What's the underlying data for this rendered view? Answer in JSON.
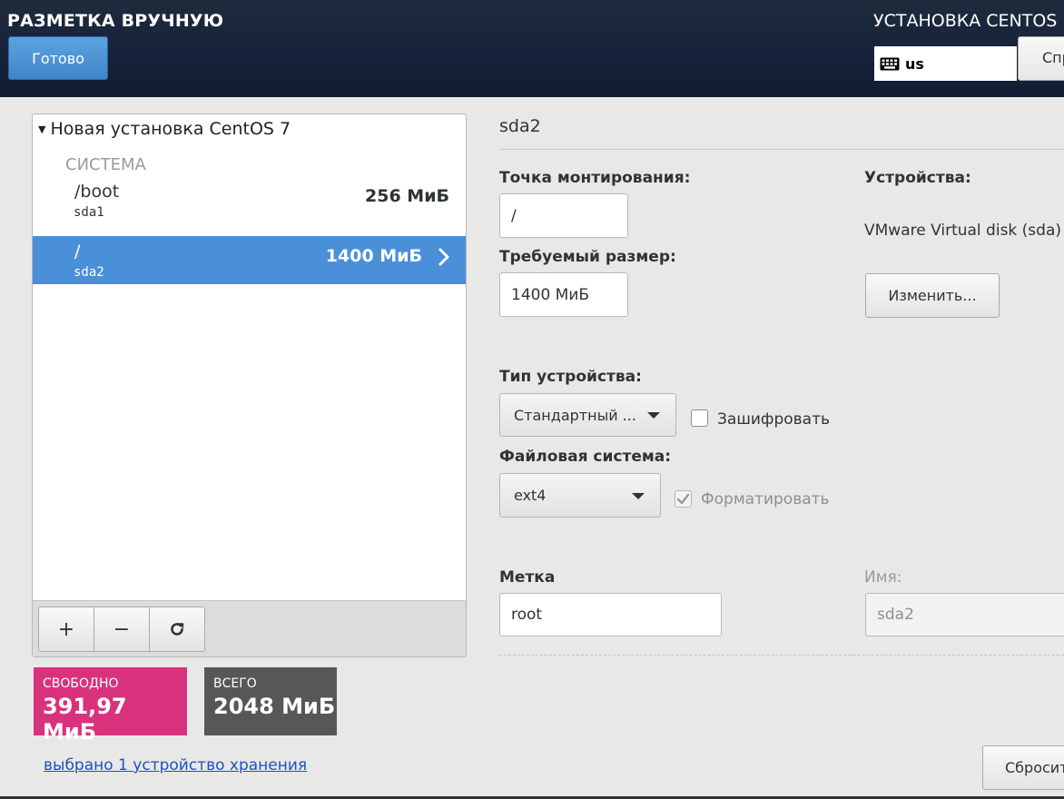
{
  "header": {
    "spoke_title": "РАЗМЕТКА ВРУЧНУЮ",
    "done_label": "Готово",
    "hub_title": "УСТАНОВКА CENTOS",
    "keyboard_layout": "us",
    "help_label": "Справка!"
  },
  "tree": {
    "root_label": "Новая установка CentOS 7",
    "section_title": "СИСТЕМА",
    "partitions": [
      {
        "mount": "/boot",
        "device": "sda1",
        "size": "256 МиБ"
      },
      {
        "mount": "/",
        "device": "sda2",
        "size": "1400 МиБ"
      }
    ],
    "toolbar": {
      "add": "+",
      "remove": "−",
      "refresh": "⟳"
    }
  },
  "space": {
    "free_label": "СВОБОДНО",
    "free_value": "391,97 МиБ",
    "total_label": "ВСЕГО",
    "total_value": "2048 МиБ"
  },
  "storage_link": "выбрано 1 устройство хранения",
  "details": {
    "title": "sda2",
    "mount_label": "Точка монтирования:",
    "mount_value": "/",
    "size_label": "Требуемый размер:",
    "size_value": "1400 МиБ",
    "devices_label": "Устройства:",
    "devices_value": "VMware Virtual disk (sda)",
    "modify_label": "Изменить...",
    "device_type_label": "Тип устройства:",
    "device_type_value": "Стандартный ...",
    "encrypt_label": "Зашифровать",
    "encrypt_checked": false,
    "fs_label": "Файловая система:",
    "fs_value": "ext4",
    "format_label": "Форматировать",
    "format_checked": true,
    "label_label": "Метка",
    "label_value": "root",
    "name_label": "Имя:",
    "name_value": "sda2",
    "reset_label": "Сбросить все"
  },
  "colors": {
    "selected_row": "#4a90d9",
    "free_space": "#d9327d",
    "total_space": "#575757",
    "done_button": "#4a90d9"
  }
}
